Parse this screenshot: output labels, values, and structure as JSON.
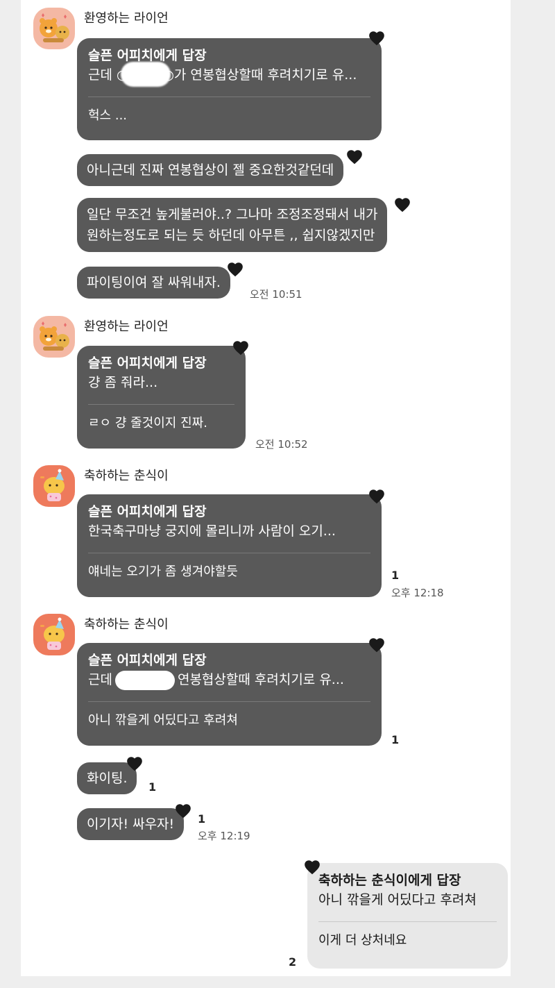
{
  "senders": {
    "ryan": "환영하는 라이언",
    "choon": "축하하는 춘식이"
  },
  "messages": {
    "m1": {
      "title": "슬픈 어피치에게 답장",
      "quote": "근데 ○○○○○가 연봉협상할때 후려치기로 유...",
      "text": "헉스 ..."
    },
    "m2": {
      "text": "아니근데 진짜 연봉협상이 젤 중요한것같던데"
    },
    "m3": {
      "line1": "일단 무조건 높게불러야..? 그나마 조정조정돼서 내가",
      "line2": "원하는정도로 되는 듯 하던데 아무튼 ,, 쉽지않겠지만"
    },
    "m4": {
      "text": "파이팅이여 잘 싸워내자.",
      "time": "오전 10:51"
    },
    "m5": {
      "title": "슬픈 어피치에게 답장",
      "quote": "걍 좀 줘라...",
      "text": "ㄹㅇ 걍 줄것이지 진짜.",
      "time": "오전 10:52"
    },
    "m6": {
      "title": "슬픈 어피치에게 답장",
      "quote": "한국축구마냥 궁지에 몰리니까 사람이 오기...",
      "text": "얘네는 오기가 좀 생겨야할듯",
      "unread": "1",
      "time": "오후 12:18"
    },
    "m7": {
      "title": "슬픈 어피치에게 답장",
      "quote_pre": "근데",
      "quote_post": "연봉협상할때 후려치기로 유...",
      "text": "아니 깎을게 어딨다고 후려쳐",
      "unread": "1"
    },
    "m8": {
      "text": "화이팅.",
      "unread": "1"
    },
    "m9": {
      "text": "이기자! 싸우자!",
      "unread": "1",
      "time": "오후 12:19"
    },
    "m10": {
      "title": "축하하는 춘식이에게 답장",
      "quote": "아니 깎을게 어딨다고 후려쳐",
      "text": "이게 더 상처네요",
      "unread": "2"
    }
  },
  "colors": {
    "bubble_other": "#595959",
    "bubble_mine": "#e8e8e8",
    "heart": "#1a1a1a",
    "ryan_avatar_bg": "#f4b8a4",
    "choon_avatar_bg": "#ee7a5c"
  }
}
